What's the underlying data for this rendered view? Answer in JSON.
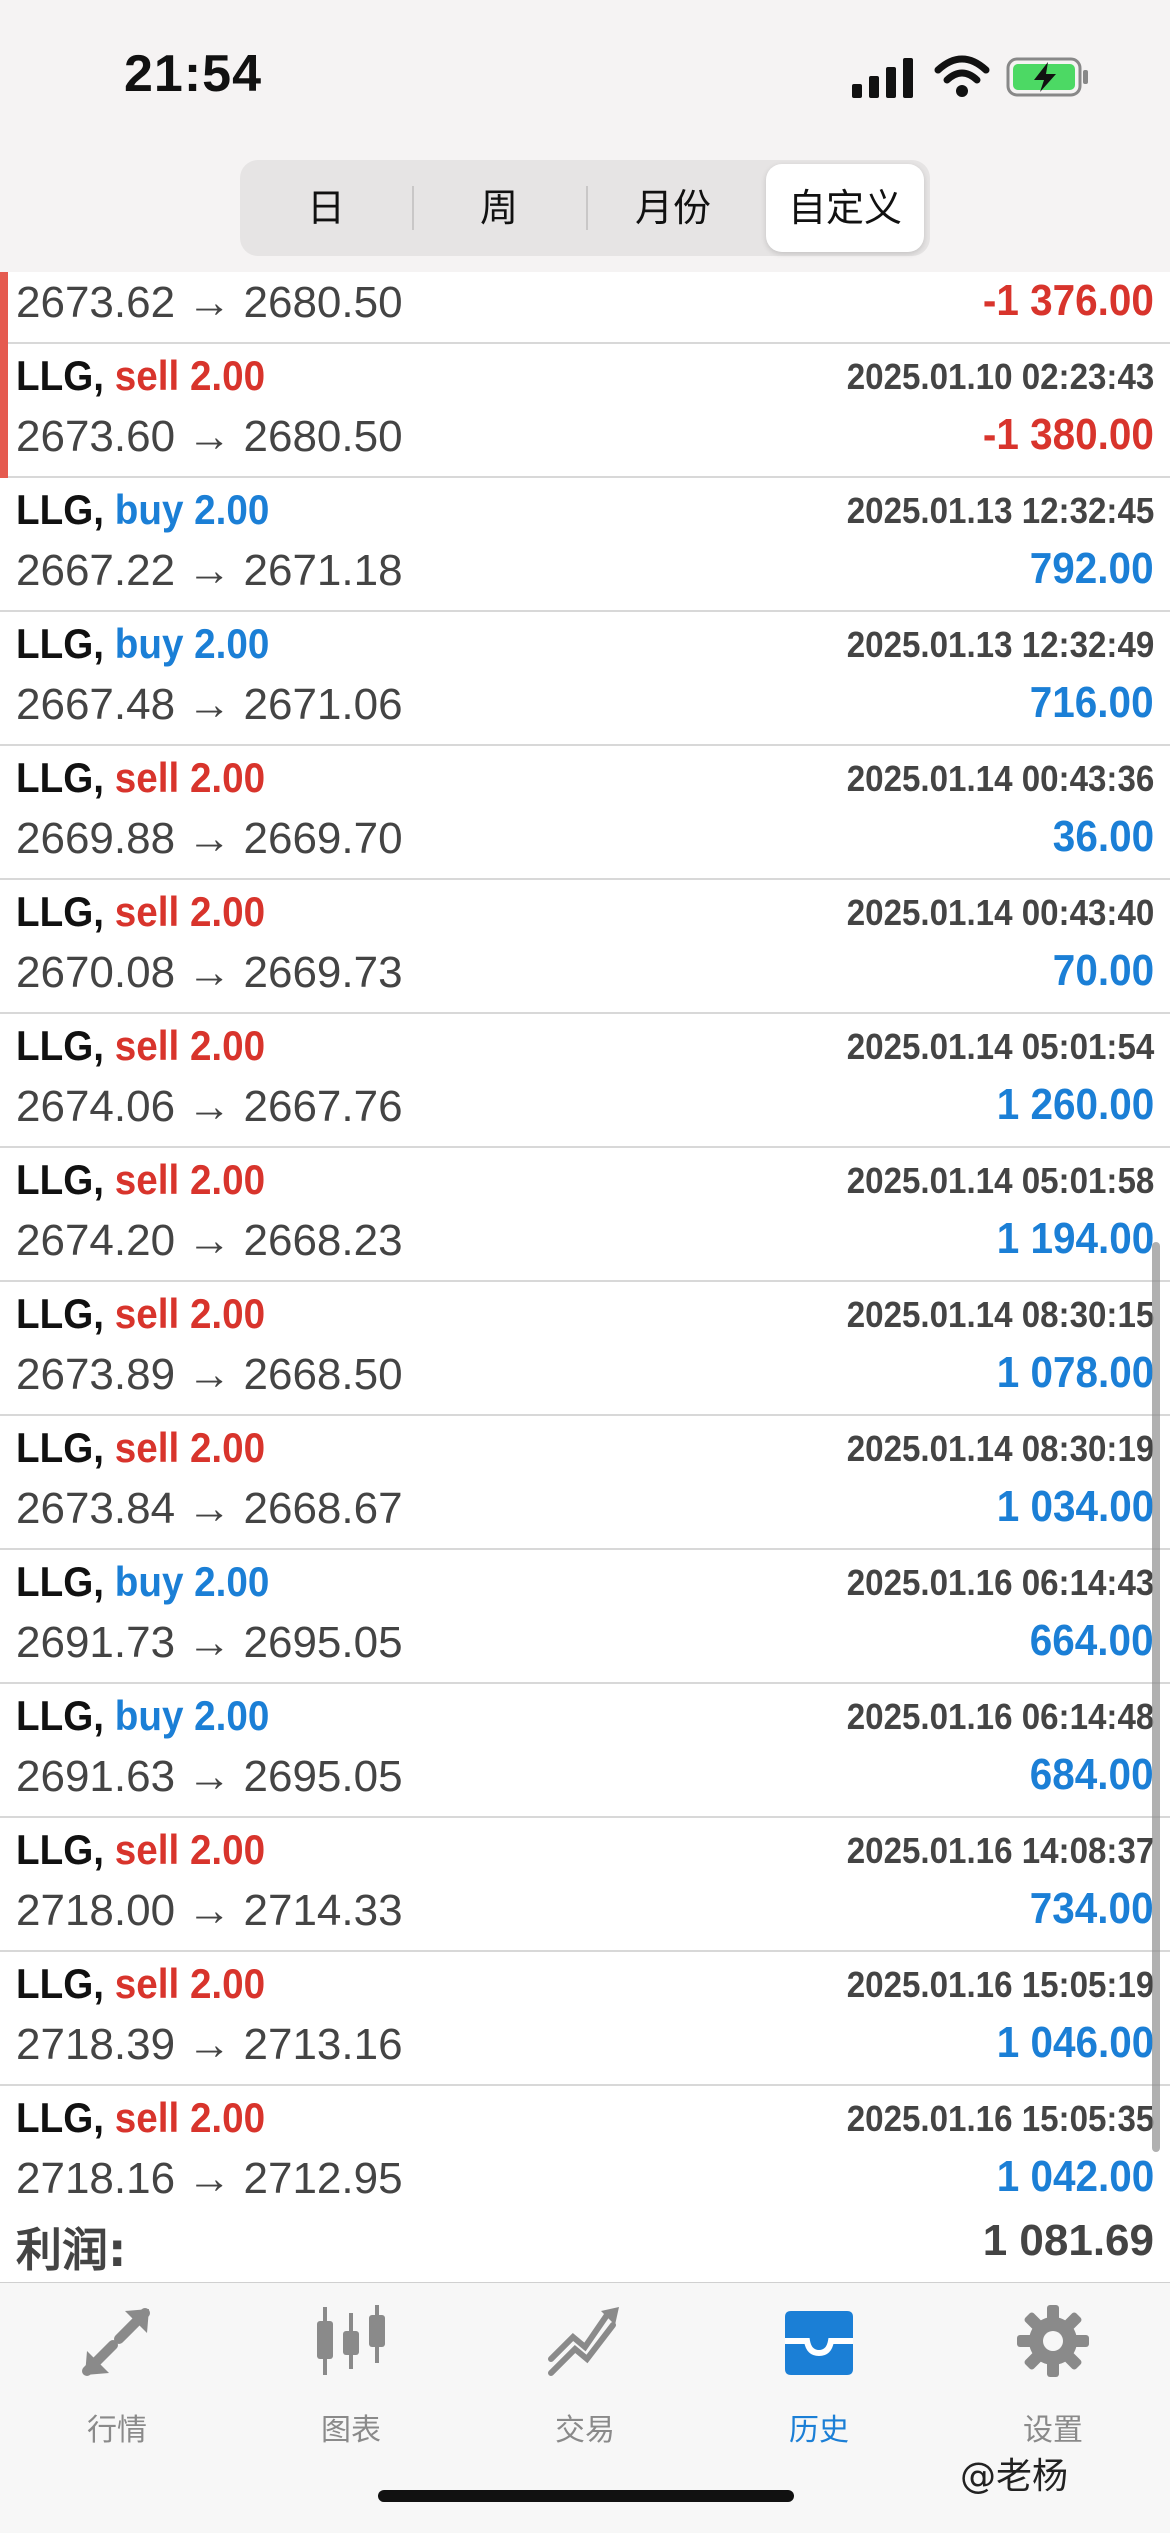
{
  "status": {
    "time": "21:54"
  },
  "segments": [
    {
      "label": "日",
      "active": false
    },
    {
      "label": "周",
      "active": false
    },
    {
      "label": "月份",
      "active": false
    },
    {
      "label": "自定义",
      "active": true
    }
  ],
  "trades": [
    {
      "symbol": "LLG,",
      "side": "sell",
      "volume": "2.00",
      "time": "",
      "price": "2673.62 → 2680.50",
      "profit": "-1 376.00",
      "marked": true
    },
    {
      "symbol": "LLG,",
      "side": "sell",
      "volume": "2.00",
      "time": "2025.01.10 02:23:43",
      "price": "2673.60 → 2680.50",
      "profit": "-1 380.00",
      "marked": true
    },
    {
      "symbol": "LLG,",
      "side": "buy",
      "volume": "2.00",
      "time": "2025.01.13 12:32:45",
      "price": "2667.22 → 2671.18",
      "profit": "792.00",
      "marked": false
    },
    {
      "symbol": "LLG,",
      "side": "buy",
      "volume": "2.00",
      "time": "2025.01.13 12:32:49",
      "price": "2667.48 → 2671.06",
      "profit": "716.00",
      "marked": false
    },
    {
      "symbol": "LLG,",
      "side": "sell",
      "volume": "2.00",
      "time": "2025.01.14 00:43:36",
      "price": "2669.88 → 2669.70",
      "profit": "36.00",
      "marked": false
    },
    {
      "symbol": "LLG,",
      "side": "sell",
      "volume": "2.00",
      "time": "2025.01.14 00:43:40",
      "price": "2670.08 → 2669.73",
      "profit": "70.00",
      "marked": false
    },
    {
      "symbol": "LLG,",
      "side": "sell",
      "volume": "2.00",
      "time": "2025.01.14 05:01:54",
      "price": "2674.06 → 2667.76",
      "profit": "1 260.00",
      "marked": false
    },
    {
      "symbol": "LLG,",
      "side": "sell",
      "volume": "2.00",
      "time": "2025.01.14 05:01:58",
      "price": "2674.20 → 2668.23",
      "profit": "1 194.00",
      "marked": false
    },
    {
      "symbol": "LLG,",
      "side": "sell",
      "volume": "2.00",
      "time": "2025.01.14 08:30:15",
      "price": "2673.89 → 2668.50",
      "profit": "1 078.00",
      "marked": false
    },
    {
      "symbol": "LLG,",
      "side": "sell",
      "volume": "2.00",
      "time": "2025.01.14 08:30:19",
      "price": "2673.84 → 2668.67",
      "profit": "1 034.00",
      "marked": false
    },
    {
      "symbol": "LLG,",
      "side": "buy",
      "volume": "2.00",
      "time": "2025.01.16 06:14:43",
      "price": "2691.73 → 2695.05",
      "profit": "664.00",
      "marked": false
    },
    {
      "symbol": "LLG,",
      "side": "buy",
      "volume": "2.00",
      "time": "2025.01.16 06:14:48",
      "price": "2691.63 → 2695.05",
      "profit": "684.00",
      "marked": false
    },
    {
      "symbol": "LLG,",
      "side": "sell",
      "volume": "2.00",
      "time": "2025.01.16 14:08:37",
      "price": "2718.00 → 2714.33",
      "profit": "734.00",
      "marked": false
    },
    {
      "symbol": "LLG,",
      "side": "sell",
      "volume": "2.00",
      "time": "2025.01.16 15:05:19",
      "price": "2718.39 → 2713.16",
      "profit": "1 046.00",
      "marked": false
    },
    {
      "symbol": "LLG,",
      "side": "sell",
      "volume": "2.00",
      "time": "2025.01.16 15:05:35",
      "price": "2718.16 → 2712.95",
      "profit": "1 042.00",
      "marked": false
    }
  ],
  "summary": {
    "label": "利润:",
    "value": "1 081.69"
  },
  "tabs": [
    {
      "label": "行情",
      "icon": "quotes-arrows-icon",
      "active": false
    },
    {
      "label": "图表",
      "icon": "candlestick-chart-icon",
      "active": false
    },
    {
      "label": "交易",
      "icon": "trade-trend-icon",
      "active": false
    },
    {
      "label": "历史",
      "icon": "history-inbox-icon",
      "active": true
    },
    {
      "label": "设置",
      "icon": "gear-icon",
      "active": false
    }
  ],
  "colors": {
    "sell": "#d8342c",
    "buy": "#1b7fd6",
    "marker": "#e55a4f",
    "tab_active": "#1b7fd6",
    "tab_inactive": "#8a8a8a"
  },
  "watermark": "@老杨"
}
